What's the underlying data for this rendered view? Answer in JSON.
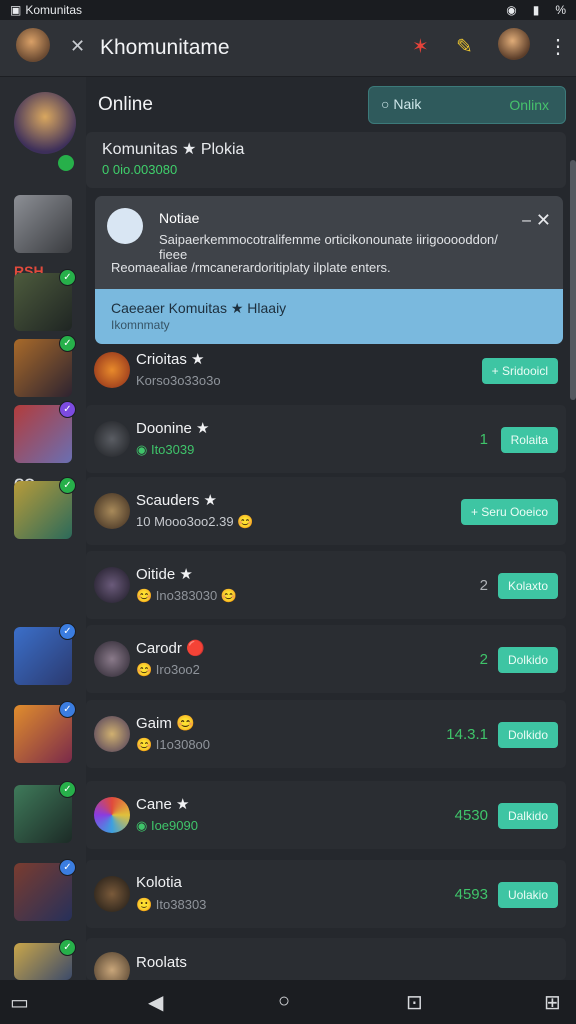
{
  "status_bar": {
    "app_name": "Komunitas",
    "signal": "%"
  },
  "header": {
    "title": "Khomunitame"
  },
  "online_section": {
    "label": "Online",
    "toggle_left": "Naik",
    "toggle_right": "Onlinx"
  },
  "community": {
    "name": "Komunitas ★ Plokia",
    "code": "0 0io.003080"
  },
  "notice": {
    "title": "Notiae",
    "body": "Saipaerkemmocotralifemme orticikonounate iirigooooddon/ fieee",
    "body2": "Reomaealiae /rmcanerardoritiplaty ilplate enters.",
    "join_title": "Caeeaer Komuitas ★ Hlaaiy",
    "join_sub": "Ikomnmaty"
  },
  "sidebar": {
    "labels": [
      "RSH",
      "CO"
    ]
  },
  "rows": [
    {
      "name": "Crioitas ★",
      "sub": "Korso3o33o3o",
      "count": "",
      "button": "+ Sridooicl"
    },
    {
      "name": "Doonine ★",
      "sub": "◉ Ito3039",
      "count": "1",
      "button": "Rolaita"
    },
    {
      "name": "Scauders ★",
      "sub": "10 Mooo3oo2.39 😊",
      "count": "",
      "button": "+ Seru Ooeico"
    },
    {
      "name": "Oitide ★",
      "sub": "😊 Ino383030 😊",
      "count": "2",
      "button": "Kolaxto"
    },
    {
      "name": "Carodr 🔴",
      "sub": "😊 Iro3oo2",
      "count": "2",
      "button": "Dolkido"
    },
    {
      "name": "Gaim 😊",
      "sub": "😊 I1o308o0",
      "count": "14.3.1",
      "button": "Dolkido"
    },
    {
      "name": "Cane ★",
      "sub": "◉ Ioe9090",
      "count": "4530",
      "button": "Dalkido"
    },
    {
      "name": "Kolotia",
      "sub": "🙂 Ito38303",
      "count": "4593",
      "button": "Uolakio"
    },
    {
      "name": "Roolats",
      "sub": "",
      "count": "",
      "button": ""
    }
  ]
}
